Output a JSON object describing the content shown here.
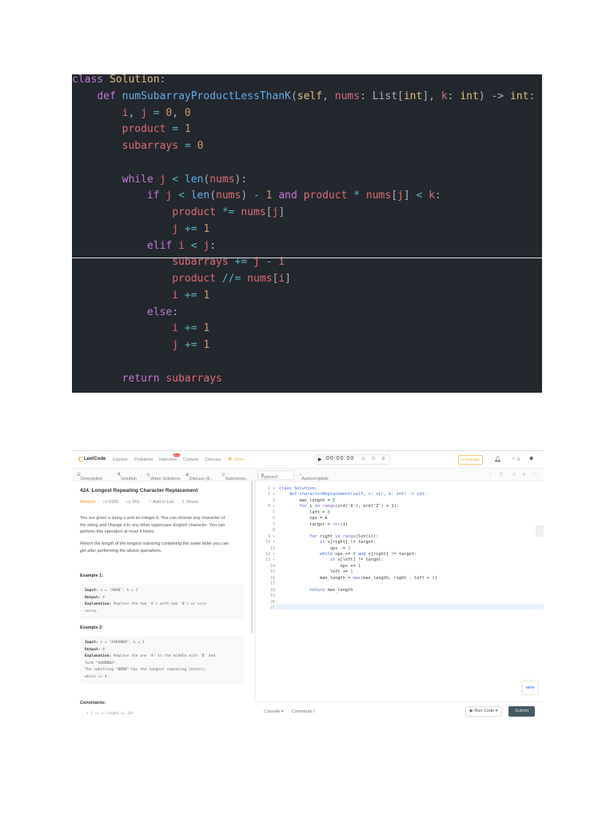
{
  "top_code": {
    "lines": [
      [
        [
          "class",
          "kw"
        ],
        [
          " ",
          "pl"
        ],
        [
          "Solution",
          "cls"
        ],
        [
          ":",
          "pl"
        ]
      ],
      [
        [
          "    ",
          "pl"
        ],
        [
          "def",
          "kw"
        ],
        [
          " ",
          "pl"
        ],
        [
          "numSubarrayProductLessThanK",
          "fn"
        ],
        [
          "(",
          "pl"
        ],
        [
          "self",
          "cls"
        ],
        [
          ", ",
          "pl"
        ],
        [
          "nums",
          "var"
        ],
        [
          ": List[",
          "pl"
        ],
        [
          "int",
          "cls"
        ],
        [
          "], ",
          "pl"
        ],
        [
          "k",
          "var"
        ],
        [
          ": ",
          "pl"
        ],
        [
          "int",
          "cls"
        ],
        [
          ") -> ",
          "pl"
        ],
        [
          "int",
          "cls"
        ],
        [
          ":",
          "pl"
        ]
      ],
      [
        [
          "        ",
          "pl"
        ],
        [
          "i",
          "var"
        ],
        [
          ", ",
          "pl"
        ],
        [
          "j",
          "var"
        ],
        [
          " = ",
          "op"
        ],
        [
          "0",
          "num"
        ],
        [
          ", ",
          "pl"
        ],
        [
          "0",
          "num"
        ]
      ],
      [
        [
          "        ",
          "pl"
        ],
        [
          "product",
          "var"
        ],
        [
          " = ",
          "op"
        ],
        [
          "1",
          "num"
        ]
      ],
      [
        [
          "        ",
          "pl"
        ],
        [
          "subarrays",
          "var"
        ],
        [
          " = ",
          "op"
        ],
        [
          "0",
          "num"
        ]
      ],
      [],
      [
        [
          "        ",
          "pl"
        ],
        [
          "while",
          "kw"
        ],
        [
          " ",
          "pl"
        ],
        [
          "j",
          "var"
        ],
        [
          " < ",
          "op"
        ],
        [
          "len",
          "fn"
        ],
        [
          "(",
          "pl"
        ],
        [
          "nums",
          "var"
        ],
        [
          "):",
          "pl"
        ]
      ],
      [
        [
          "            ",
          "pl"
        ],
        [
          "if",
          "kw"
        ],
        [
          " ",
          "pl"
        ],
        [
          "j",
          "var"
        ],
        [
          " < ",
          "op"
        ],
        [
          "len",
          "fn"
        ],
        [
          "(",
          "pl"
        ],
        [
          "nums",
          "var"
        ],
        [
          ") ",
          "pl"
        ],
        [
          "-",
          "op"
        ],
        [
          " ",
          "pl"
        ],
        [
          "1",
          "num"
        ],
        [
          " ",
          "pl"
        ],
        [
          "and",
          "kw"
        ],
        [
          " ",
          "pl"
        ],
        [
          "product",
          "var"
        ],
        [
          " * ",
          "op"
        ],
        [
          "nums",
          "var"
        ],
        [
          "[",
          "pl"
        ],
        [
          "j",
          "var"
        ],
        [
          "] ",
          "pl"
        ],
        [
          "<",
          "op"
        ],
        [
          " ",
          "pl"
        ],
        [
          "k",
          "var"
        ],
        [
          ":",
          "pl"
        ]
      ],
      [
        [
          "                ",
          "pl"
        ],
        [
          "product",
          "var"
        ],
        [
          " *= ",
          "op"
        ],
        [
          "nums",
          "var"
        ],
        [
          "[",
          "pl"
        ],
        [
          "j",
          "var"
        ],
        [
          "]",
          "pl"
        ]
      ],
      [
        [
          "                ",
          "pl"
        ],
        [
          "j",
          "var"
        ],
        [
          " += ",
          "op"
        ],
        [
          "1",
          "num"
        ]
      ],
      [
        [
          "            ",
          "pl"
        ],
        [
          "elif",
          "kw"
        ],
        [
          " ",
          "pl"
        ],
        [
          "i",
          "var"
        ],
        [
          " < ",
          "op"
        ],
        [
          "j",
          "var"
        ],
        [
          ":",
          "pl"
        ]
      ],
      [
        [
          "                ",
          "pl"
        ],
        [
          "subarrays",
          "var"
        ],
        [
          " += ",
          "op"
        ],
        [
          "j",
          "var"
        ],
        [
          " - ",
          "op"
        ],
        [
          "i",
          "var"
        ]
      ],
      [
        [
          "                ",
          "pl"
        ],
        [
          "product",
          "var"
        ],
        [
          " //= ",
          "op"
        ],
        [
          "nums",
          "var"
        ],
        [
          "[",
          "pl"
        ],
        [
          "i",
          "var"
        ],
        [
          "]",
          "pl"
        ]
      ],
      [
        [
          "                ",
          "pl"
        ],
        [
          "i",
          "var"
        ],
        [
          " += ",
          "op"
        ],
        [
          "1",
          "num"
        ]
      ],
      [
        [
          "            ",
          "pl"
        ],
        [
          "else",
          "kw"
        ],
        [
          ":",
          "pl"
        ]
      ],
      [
        [
          "                ",
          "pl"
        ],
        [
          "i",
          "var"
        ],
        [
          " += ",
          "op"
        ],
        [
          "1",
          "num"
        ]
      ],
      [
        [
          "                ",
          "pl"
        ],
        [
          "j",
          "var"
        ],
        [
          " += ",
          "op"
        ],
        [
          "1",
          "num"
        ]
      ],
      [],
      [
        [
          "        ",
          "pl"
        ],
        [
          "return",
          "kw"
        ],
        [
          " ",
          "pl"
        ],
        [
          "subarrays",
          "var"
        ]
      ]
    ]
  },
  "leetcode": {
    "nav": {
      "logo": "LeetCode",
      "items": [
        "Explore",
        "Problems",
        "Interview",
        "Contest",
        "Discuss",
        "Store"
      ],
      "new_badge": "New",
      "timer": "00:00:00",
      "premium": "Premium",
      "points": "0"
    },
    "tabs": [
      "Description",
      "Solution",
      "Video Solutions",
      "Discuss (8...",
      "Submissio..."
    ],
    "language": "Python3",
    "autocomplete": "Autocomplete",
    "problem": {
      "title": "424. Longest Repeating Character Replacement",
      "difficulty": "Medium",
      "likes": "6980",
      "dislikes": "269",
      "add_to_list": "Add to List",
      "share": "Share",
      "desc1": "You are given a string s and an integer k. You can choose any character of",
      "desc2": "the string and change it to any other uppercase English character. You can",
      "desc3": "perform this operation at most k times.",
      "desc4": "Return the length of the longest substring containing the same letter you can",
      "desc5": "get after performing the above operations.",
      "ex1_title": "Example 1:",
      "ex1": {
        "input": "s = \"ABAB\", k = 2",
        "output": "4",
        "explanation": "Replace the two 'A's with two 'B's or vice",
        "explanation2": "versa."
      },
      "ex2_title": "Example 2:",
      "ex2": {
        "input": "s = \"AABABBA\", k = 1",
        "output": "4",
        "explanation": "Replace the one 'A' in the middle with 'B' and",
        "explanation2": "form \"AABBBBA\".",
        "explanation3": "The substring \"BBBB\" has the longest repeating letters,",
        "explanation4": "which is 4."
      },
      "labels": {
        "input": "Input:",
        "output": "Output:",
        "explanation": "Explanation:"
      },
      "constraints_title": "Constraints:",
      "constraint1": "1 <= s.length <= 10⁵"
    },
    "editor_lines": [
      [
        [
          "class ",
          "k2"
        ],
        [
          "Solution:",
          "k2"
        ]
      ],
      [
        [
          "    def ",
          "k2"
        ],
        [
          "characterReplacement",
          "b2"
        ],
        [
          "(self, s: str, k: int) -> int:",
          "k2"
        ]
      ],
      [
        [
          "        max_length = ",
          ""
        ],
        [
          "0",
          "n2"
        ]
      ],
      [
        [
          "        for ",
          "k2"
        ],
        [
          "i ",
          ""
        ],
        [
          "in ",
          "k2"
        ],
        [
          "range",
          "f2"
        ],
        [
          "(ord('A'), ord('Z') + 1):",
          ""
        ]
      ],
      [
        [
          "            left = ",
          ""
        ],
        [
          "0",
          "n2"
        ]
      ],
      [
        [
          "            ops = k",
          ""
        ]
      ],
      [
        [
          "            target = ",
          ""
        ],
        [
          "chr",
          "f2"
        ],
        [
          "(i)",
          ""
        ]
      ],
      [],
      [
        [
          "            for ",
          "k2"
        ],
        [
          "right ",
          ""
        ],
        [
          "in ",
          "k2"
        ],
        [
          "range",
          "f2"
        ],
        [
          "(len(s)):",
          ""
        ]
      ],
      [
        [
          "                if ",
          "k2"
        ],
        [
          "s[right] != target:",
          ""
        ]
      ],
      [
        [
          "                    ops -= ",
          ""
        ],
        [
          "1",
          "n2"
        ]
      ],
      [
        [
          "                while ",
          "k2"
        ],
        [
          "ops <= ",
          ""
        ],
        [
          "0",
          "n2"
        ],
        [
          " and ",
          "k2"
        ],
        [
          "s[right] != target:",
          ""
        ]
      ],
      [
        [
          "                    if ",
          "k2"
        ],
        [
          "s[left] != target:",
          ""
        ]
      ],
      [
        [
          "                        ops += ",
          ""
        ],
        [
          "1",
          "n2"
        ]
      ],
      [
        [
          "                    left += ",
          ""
        ],
        [
          "1",
          "n2"
        ]
      ],
      [
        [
          "                max_length = ",
          ""
        ],
        [
          "max",
          "f2"
        ],
        [
          "(max_length, right - left + ",
          ""
        ],
        [
          "1",
          "n2"
        ],
        [
          ")",
          ""
        ]
      ],
      [],
      [
        [
          "            return ",
          "k2"
        ],
        [
          "max_length",
          ""
        ]
      ],
      [],
      [],
      []
    ],
    "gutter_folds": [
      1,
      2,
      4,
      9,
      10,
      12,
      13
    ],
    "new_label": "NEW",
    "footer": {
      "console": "Console",
      "contribute": "Contribute",
      "run": "Run Code",
      "submit": "Submit"
    }
  }
}
